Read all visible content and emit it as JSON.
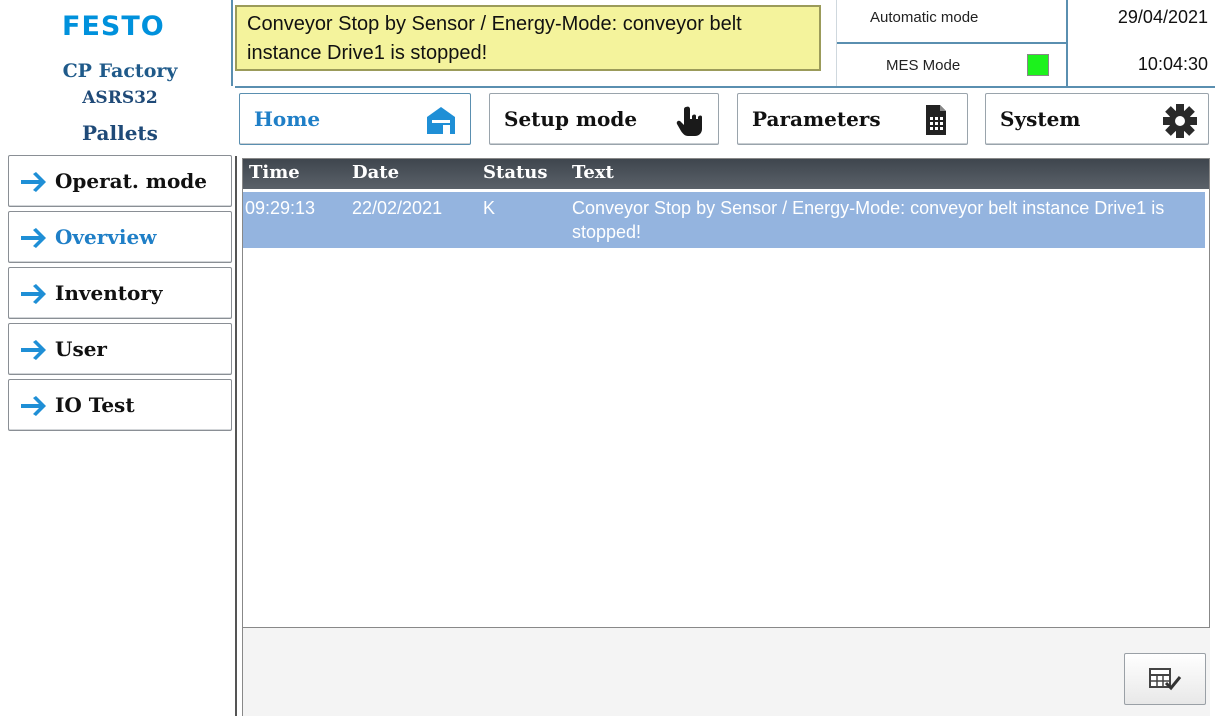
{
  "branding": {
    "logo": "FESTO",
    "line1": "CP Factory",
    "line2": "ASRS32",
    "line3": "Pallets"
  },
  "header": {
    "alarm_text": "Conveyor Stop by Sensor / Energy-Mode: conveyor belt instance Drive1 is stopped!",
    "mode": "Automatic mode",
    "mes_label": "MES Mode",
    "mes_color": "#1cf21c",
    "date": "29/04/2021",
    "time": "10:04:30"
  },
  "tabs": [
    {
      "label": "Home",
      "icon": "home-icon",
      "active": true
    },
    {
      "label": "Setup mode",
      "icon": "hand-pointer-icon"
    },
    {
      "label": "Parameters",
      "icon": "calculator-doc-icon"
    },
    {
      "label": "System",
      "icon": "gear-icon"
    }
  ],
  "sidebar": {
    "items": [
      {
        "label": "Operat. mode"
      },
      {
        "label": "Overview",
        "active": true
      },
      {
        "label": "Inventory"
      },
      {
        "label": "User"
      },
      {
        "label": "IO Test"
      }
    ]
  },
  "alarm_table": {
    "columns": [
      "Time",
      "Date",
      "Status",
      "Text"
    ],
    "rows": [
      {
        "time": "09:29:13",
        "date": "22/02/2021",
        "status": "K",
        "text": "Conveyor Stop by Sensor / Energy-Mode: conveyor belt instance Drive1 is stopped!"
      }
    ]
  },
  "colors": {
    "brand": "#0091dc",
    "accent": "#1f7fc7",
    "alarm_bg": "#f4f39c",
    "row_selected": "#94b4df"
  }
}
